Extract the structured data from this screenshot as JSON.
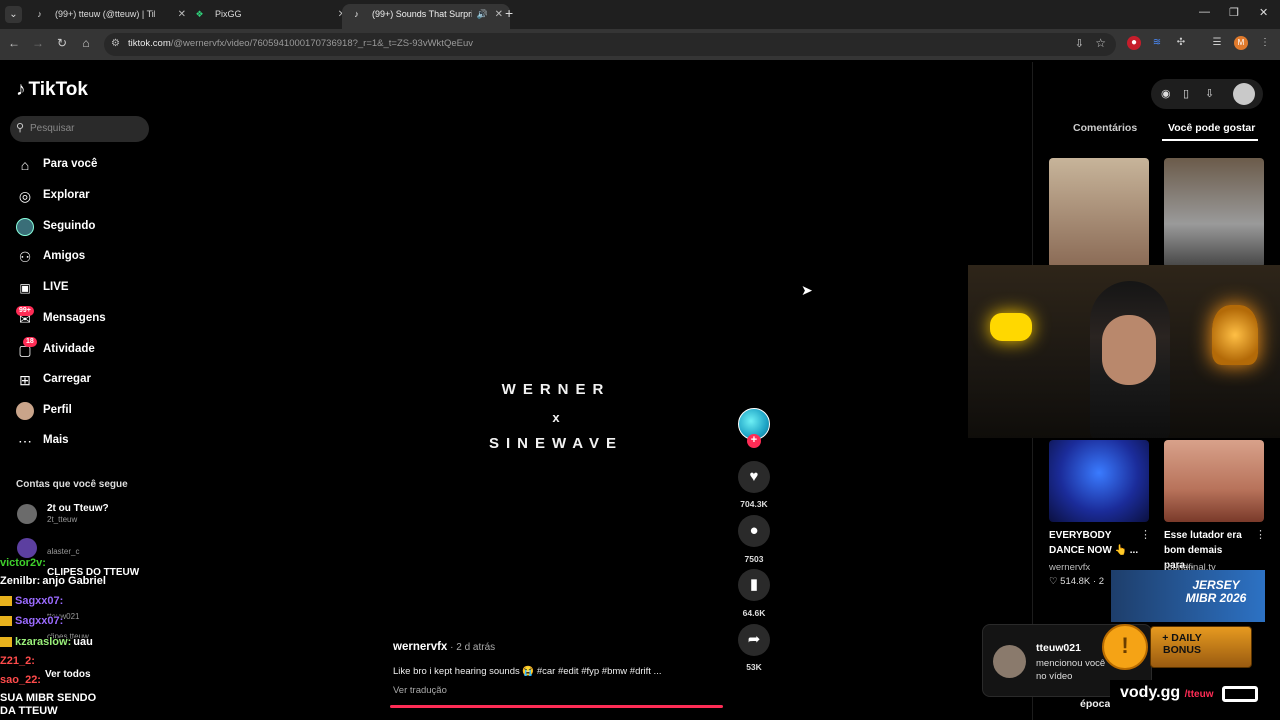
{
  "browser": {
    "tabs": [
      {
        "label": "(99+) tteuw (@tteuw) | TikTok",
        "icon": "tiktok-icon"
      },
      {
        "label": "PixGG",
        "icon": "pixgg-icon"
      },
      {
        "label": "(99+) Sounds That Surprise",
        "icon": "tiktok-icon"
      }
    ],
    "url_host": "tiktok.com",
    "url_path": "/@wernervfx/video/7605941000170736918?_r=1&_t=ZS-93vWktQeEuv"
  },
  "sidebar": {
    "logo": "TikTok",
    "search_placeholder": "Pesquisar",
    "nav": [
      {
        "label": "Para você",
        "icon": "home-icon"
      },
      {
        "label": "Explorar",
        "icon": "compass-icon"
      },
      {
        "label": "Seguindo",
        "icon": "following-icon"
      },
      {
        "label": "Amigos",
        "icon": "friends-icon"
      },
      {
        "label": "LIVE",
        "icon": "live-icon"
      },
      {
        "label": "Mensagens",
        "icon": "messages-icon",
        "badge": "99+"
      },
      {
        "label": "Atividade",
        "icon": "activity-icon",
        "badge": "18"
      },
      {
        "label": "Carregar",
        "icon": "upload-icon"
      },
      {
        "label": "Perfil",
        "icon": "profile-icon"
      },
      {
        "label": "Mais",
        "icon": "more-icon"
      }
    ],
    "following_title": "Contas que você segue",
    "accounts": [
      {
        "name": "2t ou Tteuw?",
        "handle": "2t_tteuw"
      },
      {
        "name": "",
        "handle": "alaster_c"
      },
      {
        "name": "CLIPES DO TTEUW",
        "handle": ""
      },
      {
        "name": "",
        "handle": "tteuw021"
      },
      {
        "name": "",
        "handle": "clipes.tteuw"
      }
    ],
    "see_all": "Ver todos"
  },
  "chat": [
    {
      "user": "victor2v:",
      "msg": "",
      "color": "#3fd12c"
    },
    {
      "user": "Zenilbr:",
      "msg": "anjo Gabriel",
      "color": "#ffffff"
    },
    {
      "user": "Sagxx07:",
      "msg": "",
      "color": "#9b6bff"
    },
    {
      "user": "Sagxx07:",
      "msg": "",
      "color": "#9b6bff"
    },
    {
      "user": "kzaraslow:",
      "msg": "uau",
      "color": "#9af07a"
    },
    {
      "user": "Z21_2:",
      "msg": "",
      "color": "#ff4b4b"
    },
    {
      "user": "sao_22:",
      "msg": "",
      "color": "#ff4b4b"
    },
    {
      "user": "",
      "msg": "SUA MIBR SENDO",
      "color": "#ffffff"
    },
    {
      "user": "",
      "msg": "DA TTEUW",
      "color": "#ffffff"
    }
  ],
  "video": {
    "line1": "WERNER",
    "line2": "x",
    "line3": "SINEWAVE",
    "author": "wernervfx",
    "time": " · 2 d atrás",
    "description": "Like bro i kept hearing sounds 😭 #car #edit #fyp #bmw #drift ...",
    "translate": "Ver tradução",
    "likes": "704.3K",
    "comments": "7503",
    "saves": "64.6K",
    "shares": "53K"
  },
  "right_panel": {
    "tab_comments": "Comentários",
    "tab_suggested": "Você pode gostar",
    "cards": [
      {
        "title": "EVERYBODY DANCE NOW 👆 ...",
        "author": "wernervfx",
        "stats": "♡ 514.8K · 2"
      },
      {
        "title": "Esse lutador era bom demais para...",
        "author": "roundfinal.tv",
        "stats": ""
      }
    ]
  },
  "notification": {
    "name": "tteuw021",
    "text": "mencionou você no vídeo"
  },
  "overlays": {
    "jersey_line1": "JERSEY",
    "jersey_line2": "MIBR 2026",
    "bonus": "+ DAILY BONUS",
    "vody": "vody.gg",
    "vody_handle": "/tteuw",
    "epoca": "época"
  },
  "colors": {
    "accent": "#fe2c55",
    "background": "#000000"
  }
}
